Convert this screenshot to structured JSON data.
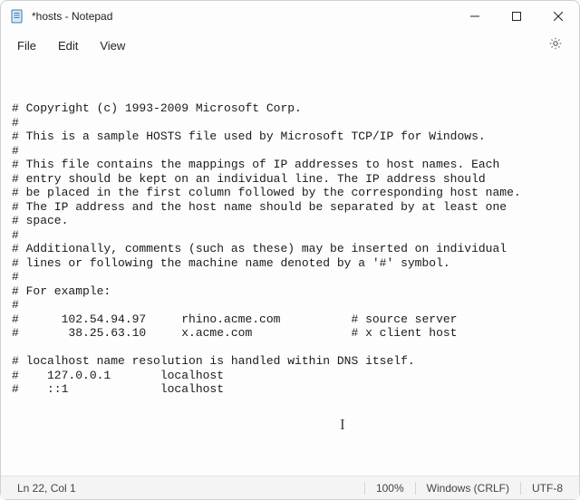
{
  "window": {
    "title": "*hosts - Notepad"
  },
  "menu": {
    "file": "File",
    "edit": "Edit",
    "view": "View"
  },
  "editor": {
    "content": "# Copyright (c) 1993-2009 Microsoft Corp.\n#\n# This is a sample HOSTS file used by Microsoft TCP/IP for Windows.\n#\n# This file contains the mappings of IP addresses to host names. Each\n# entry should be kept on an individual line. The IP address should\n# be placed in the first column followed by the corresponding host name.\n# The IP address and the host name should be separated by at least one\n# space.\n#\n# Additionally, comments (such as these) may be inserted on individual\n# lines or following the machine name denoted by a '#' symbol.\n#\n# For example:\n#\n#      102.54.94.97     rhino.acme.com          # source server\n#       38.25.63.10     x.acme.com              # x client host\n\n# localhost name resolution is handled within DNS itself.\n#    127.0.0.1       localhost\n#    ::1             localhost"
  },
  "statusbar": {
    "position": "Ln 22, Col 1",
    "zoom": "100%",
    "line_ending": "Windows (CRLF)",
    "encoding": "UTF-8"
  }
}
